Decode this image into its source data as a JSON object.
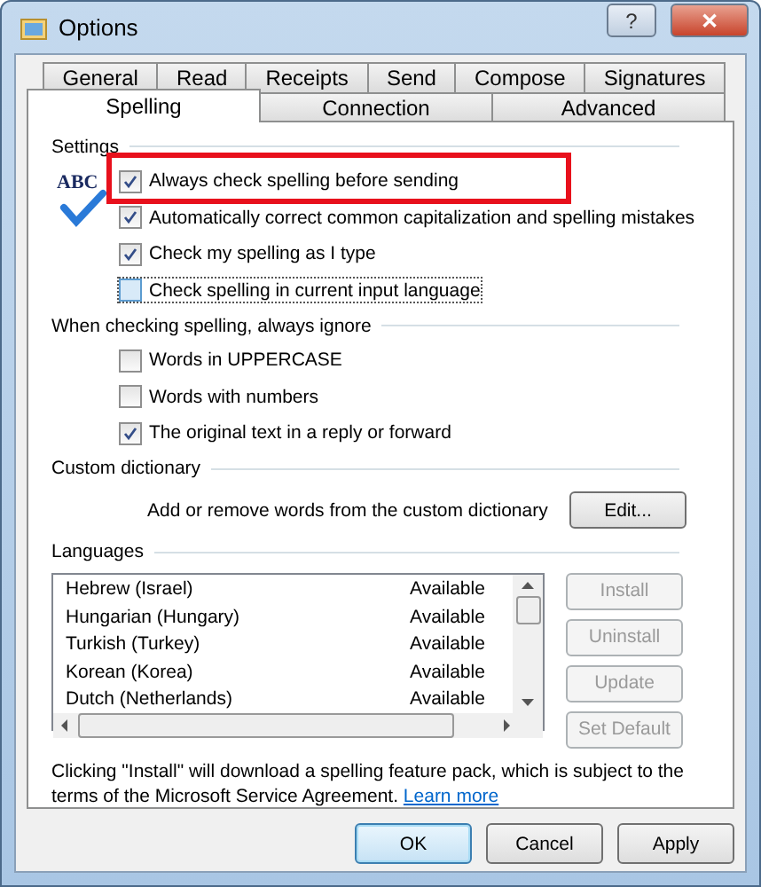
{
  "window": {
    "title": "Options",
    "help": "?",
    "close": "✕"
  },
  "tabs": [
    [
      {
        "label": "General",
        "selected": false
      },
      {
        "label": "Read",
        "selected": false
      },
      {
        "label": "Receipts",
        "selected": false
      },
      {
        "label": "Send",
        "selected": false
      },
      {
        "label": "Compose",
        "selected": false
      },
      {
        "label": "Signatures",
        "selected": false
      }
    ],
    [
      {
        "label": "Spelling",
        "selected": true
      },
      {
        "label": "Connection",
        "selected": false
      },
      {
        "label": "Advanced",
        "selected": false
      }
    ]
  ],
  "settings": {
    "title": "Settings",
    "icon_text": "ABC",
    "items": [
      {
        "label": "Always check spelling before sending",
        "checked": true,
        "highlighted": true,
        "focused": false
      },
      {
        "label": "Automatically correct common capitalization and spelling mistakes",
        "checked": true,
        "highlighted": false,
        "focused": false
      },
      {
        "label": "Check my spelling as I type",
        "checked": true,
        "highlighted": false,
        "focused": false
      },
      {
        "label": "Check spelling in current input language",
        "checked": false,
        "highlighted": false,
        "focused": true
      }
    ]
  },
  "ignore": {
    "title": "When checking spelling, always ignore",
    "items": [
      {
        "label": "Words in UPPERCASE",
        "checked": false
      },
      {
        "label": "Words with numbers",
        "checked": false
      },
      {
        "label": "The original text in a reply or forward",
        "checked": true
      }
    ]
  },
  "custom_dictionary": {
    "title": "Custom dictionary",
    "text": "Add or remove words from the custom dictionary",
    "button": "Edit..."
  },
  "languages": {
    "title": "Languages",
    "rows": [
      {
        "name": "Hebrew (Israel)",
        "status": "Available"
      },
      {
        "name": "Hungarian (Hungary)",
        "status": "Available"
      },
      {
        "name": "Turkish (Turkey)",
        "status": "Available"
      },
      {
        "name": "Korean (Korea)",
        "status": "Available"
      },
      {
        "name": "Dutch (Netherlands)",
        "status": "Available"
      }
    ],
    "buttons": [
      {
        "label": "Install",
        "disabled": true
      },
      {
        "label": "Uninstall",
        "disabled": true
      },
      {
        "label": "Update",
        "disabled": true
      },
      {
        "label": "Set Default",
        "disabled": true
      }
    ]
  },
  "note": "Clicking \"Install\" will download a spelling feature pack, which is subject to the terms of the Microsoft Service Agreement.",
  "note_link": "Learn more",
  "buttons": [
    {
      "label": "OK",
      "default": true
    },
    {
      "label": "Cancel",
      "default": false
    },
    {
      "label": "Apply",
      "default": false
    }
  ]
}
